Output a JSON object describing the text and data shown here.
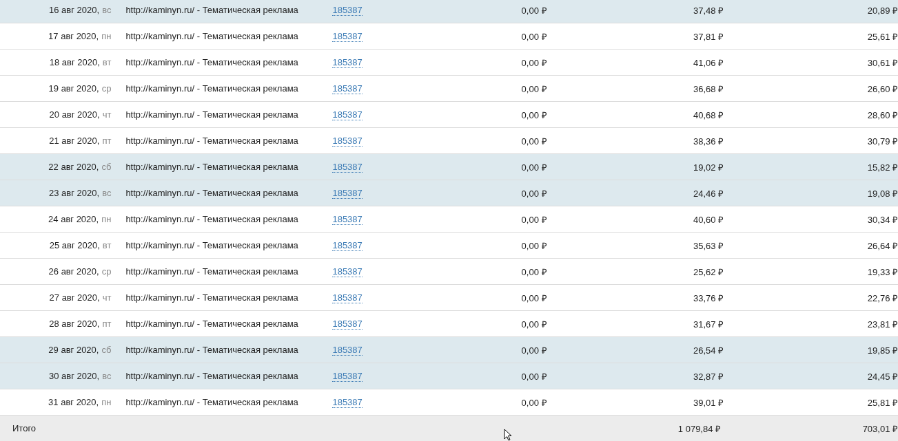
{
  "table": {
    "rows": [
      {
        "date": "16 авг 2020,",
        "weekday": "вс",
        "weekend": true,
        "source": "http://kaminyn.ru/ - Тематическая реклама",
        "link": "185387",
        "column_4": "0,00 ₽",
        "column_5": "37,48 ₽",
        "column_6": "20,89 ₽"
      },
      {
        "date": "17 авг 2020,",
        "weekday": "пн",
        "weekend": false,
        "source": "http://kaminyn.ru/ - Тематическая реклама",
        "link": "185387",
        "column_4": "0,00 ₽",
        "column_5": "37,81 ₽",
        "column_6": "25,61 ₽"
      },
      {
        "date": "18 авг 2020,",
        "weekday": "вт",
        "weekend": false,
        "source": "http://kaminyn.ru/ - Тематическая реклама",
        "link": "185387",
        "column_4": "0,00 ₽",
        "column_5": "41,06 ₽",
        "column_6": "30,61 ₽"
      },
      {
        "date": "19 авг 2020,",
        "weekday": "ср",
        "weekend": false,
        "source": "http://kaminyn.ru/ - Тематическая реклама",
        "link": "185387",
        "column_4": "0,00 ₽",
        "column_5": "36,68 ₽",
        "column_6": "26,60 ₽"
      },
      {
        "date": "20 авг 2020,",
        "weekday": "чт",
        "weekend": false,
        "source": "http://kaminyn.ru/ - Тематическая реклама",
        "link": "185387",
        "column_4": "0,00 ₽",
        "column_5": "40,68 ₽",
        "column_6": "28,60 ₽"
      },
      {
        "date": "21 авг 2020,",
        "weekday": "пт",
        "weekend": false,
        "source": "http://kaminyn.ru/ - Тематическая реклама",
        "link": "185387",
        "column_4": "0,00 ₽",
        "column_5": "38,36 ₽",
        "column_6": "30,79 ₽"
      },
      {
        "date": "22 авг 2020,",
        "weekday": "сб",
        "weekend": true,
        "source": "http://kaminyn.ru/ - Тематическая реклама",
        "link": "185387",
        "column_4": "0,00 ₽",
        "column_5": "19,02 ₽",
        "column_6": "15,82 ₽"
      },
      {
        "date": "23 авг 2020,",
        "weekday": "вс",
        "weekend": true,
        "source": "http://kaminyn.ru/ - Тематическая реклама",
        "link": "185387",
        "column_4": "0,00 ₽",
        "column_5": "24,46 ₽",
        "column_6": "19,08 ₽"
      },
      {
        "date": "24 авг 2020,",
        "weekday": "пн",
        "weekend": false,
        "source": "http://kaminyn.ru/ - Тематическая реклама",
        "link": "185387",
        "column_4": "0,00 ₽",
        "column_5": "40,60 ₽",
        "column_6": "30,34 ₽"
      },
      {
        "date": "25 авг 2020,",
        "weekday": "вт",
        "weekend": false,
        "source": "http://kaminyn.ru/ - Тематическая реклама",
        "link": "185387",
        "column_4": "0,00 ₽",
        "column_5": "35,63 ₽",
        "column_6": "26,64 ₽"
      },
      {
        "date": "26 авг 2020,",
        "weekday": "ср",
        "weekend": false,
        "source": "http://kaminyn.ru/ - Тематическая реклама",
        "link": "185387",
        "column_4": "0,00 ₽",
        "column_5": "25,62 ₽",
        "column_6": "19,33 ₽"
      },
      {
        "date": "27 авг 2020,",
        "weekday": "чт",
        "weekend": false,
        "source": "http://kaminyn.ru/ - Тематическая реклама",
        "link": "185387",
        "column_4": "0,00 ₽",
        "column_5": "33,76 ₽",
        "column_6": "22,76 ₽"
      },
      {
        "date": "28 авг 2020,",
        "weekday": "пт",
        "weekend": false,
        "source": "http://kaminyn.ru/ - Тематическая реклама",
        "link": "185387",
        "column_4": "0,00 ₽",
        "column_5": "31,67 ₽",
        "column_6": "23,81 ₽"
      },
      {
        "date": "29 авг 2020,",
        "weekday": "сб",
        "weekend": true,
        "source": "http://kaminyn.ru/ - Тематическая реклама",
        "link": "185387",
        "column_4": "0,00 ₽",
        "column_5": "26,54 ₽",
        "column_6": "19,85 ₽"
      },
      {
        "date": "30 авг 2020,",
        "weekday": "вс",
        "weekend": true,
        "source": "http://kaminyn.ru/ - Тематическая реклама",
        "link": "185387",
        "column_4": "0,00 ₽",
        "column_5": "32,87 ₽",
        "column_6": "24,45 ₽"
      },
      {
        "date": "31 авг 2020,",
        "weekday": "пн",
        "weekend": false,
        "source": "http://kaminyn.ru/ - Тематическая реклама",
        "link": "185387",
        "column_4": "0,00 ₽",
        "column_5": "39,01 ₽",
        "column_6": "25,81 ₽"
      }
    ],
    "total": {
      "label": "Итого",
      "column_5": "1 079,84 ₽",
      "column_6": "703,01 ₽"
    }
  }
}
